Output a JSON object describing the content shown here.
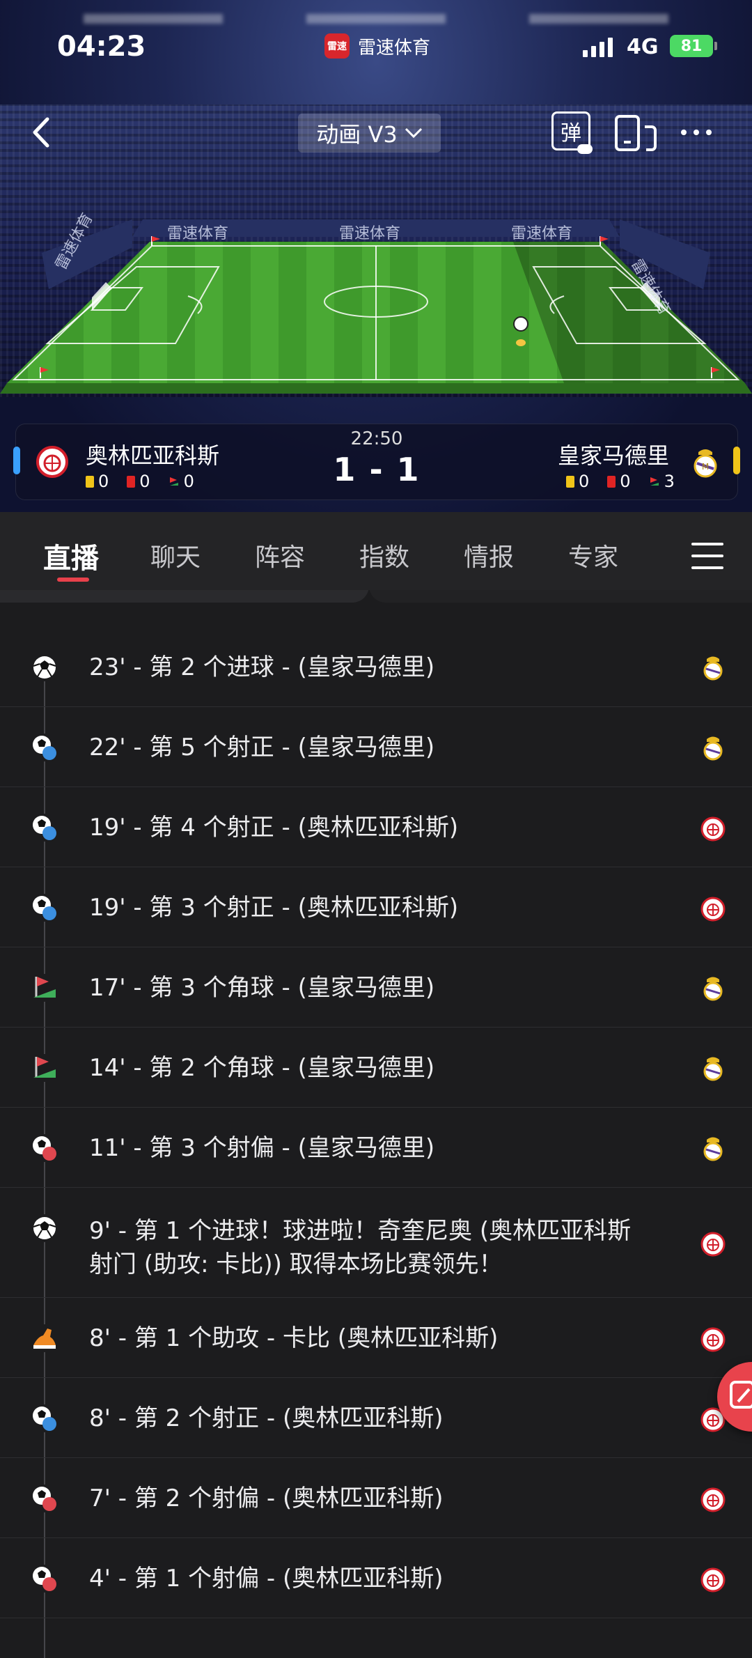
{
  "status": {
    "time": "04:23",
    "app_badge": "雷速",
    "app_name": "雷速体育",
    "network": "4G",
    "battery": "81"
  },
  "header": {
    "mode_label": "动画 V3",
    "danmu_label": "弹",
    "ad_text": "雷速体育"
  },
  "match": {
    "time": "22:50",
    "score": "1 - 1",
    "home": {
      "name": "奥林匹亚科斯",
      "yellow": "0",
      "red": "0",
      "corners": "0",
      "color": "#3aa0ff"
    },
    "away": {
      "name": "皇家马德里",
      "yellow": "0",
      "red": "0",
      "corners": "3",
      "color": "#f0c419"
    }
  },
  "tabs": [
    {
      "label": "直播",
      "active": true
    },
    {
      "label": "聊天"
    },
    {
      "label": "阵容"
    },
    {
      "label": "指数"
    },
    {
      "label": "情报"
    },
    {
      "label": "专家"
    }
  ],
  "events": [
    {
      "type": "goal",
      "text": "23' - 第 2 个进球 - (皇家马德里)",
      "team": "away"
    },
    {
      "type": "shot-on",
      "text": "22' - 第 5 个射正 - (皇家马德里)",
      "team": "away"
    },
    {
      "type": "shot-on",
      "text": "19' - 第 4 个射正 - (奥林匹亚科斯)",
      "team": "home"
    },
    {
      "type": "shot-on",
      "text": "19' - 第 3 个射正 - (奥林匹亚科斯)",
      "team": "home"
    },
    {
      "type": "corner",
      "text": "17' - 第 3 个角球 - (皇家马德里)",
      "team": "away"
    },
    {
      "type": "corner",
      "text": "14' - 第 2 个角球 - (皇家马德里)",
      "team": "away"
    },
    {
      "type": "shot-off",
      "text": "11' - 第 3 个射偏 - (皇家马德里)",
      "team": "away"
    },
    {
      "type": "goal",
      "text": "9' - 第 1 个进球！球进啦！奇奎尼奥 (奥林匹亚科斯 射门 (助攻: 卡比)) 取得本场比赛领先！",
      "team": "home"
    },
    {
      "type": "assist",
      "text": "8' - 第 1 个助攻 - 卡比 (奥林匹亚科斯)",
      "team": "home"
    },
    {
      "type": "shot-on",
      "text": "8' - 第 2 个射正 - (奥林匹亚科斯)",
      "team": "home"
    },
    {
      "type": "shot-off",
      "text": "7' - 第 2 个射偏 - (奥林匹亚科斯)",
      "team": "home"
    },
    {
      "type": "shot-off",
      "text": "4' - 第 1 个射偏 - (奥林匹亚科斯)",
      "team": "home"
    }
  ],
  "icon_labels": {
    "shot-on": "正",
    "shot-off": "偏"
  }
}
